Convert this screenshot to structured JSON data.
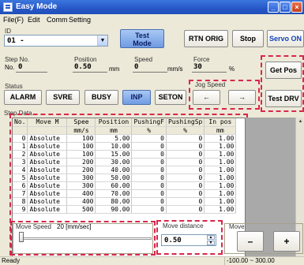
{
  "window": {
    "title": "Easy Mode"
  },
  "menu": [
    "File(F)",
    "Edit",
    "Comm",
    "Setting"
  ],
  "id": {
    "label": "ID",
    "value": "01 -"
  },
  "buttons": {
    "test_mode_line1": "Test",
    "test_mode_line2": "Mode",
    "rtn_orig": "RTN ORIG",
    "stop": "Stop",
    "servo_on": "Servo ON",
    "get_pos": "Get Pos",
    "test_drv": "Test DRV"
  },
  "readouts": {
    "step_no_label": "Step No.",
    "step_no_prefix": "No.",
    "step_no_value": "0",
    "position_label": "Position",
    "position_value": "0.50",
    "position_unit": "mm",
    "speed_label": "Speed",
    "speed_value": "0",
    "speed_unit": "mm/s",
    "force_label": "Force",
    "force_value": "30",
    "force_unit": "%"
  },
  "status": {
    "label": "Status",
    "badges": [
      "ALARM",
      "SVRE",
      "BUSY",
      "INP",
      "SETON"
    ]
  },
  "jog": {
    "label": "Jog Speed",
    "left": "←",
    "right": "→"
  },
  "step_data": {
    "label": "Step Data",
    "headers": [
      "No.",
      "Move M",
      "Spee",
      "Position",
      "PushingF",
      "PushingSp",
      "In pos"
    ],
    "units": [
      "",
      "",
      "mm/s",
      "mm",
      "%",
      "%",
      "mm"
    ],
    "rows": [
      [
        "0",
        "Absolute",
        "100",
        "5.00",
        "0",
        "0",
        "1.00"
      ],
      [
        "1",
        "Absolute",
        "100",
        "10.00",
        "0",
        "0",
        "1.00"
      ],
      [
        "2",
        "Absolute",
        "100",
        "15.00",
        "0",
        "0",
        "1.00"
      ],
      [
        "3",
        "Absolute",
        "200",
        "30.00",
        "0",
        "0",
        "1.00"
      ],
      [
        "4",
        "Absolute",
        "200",
        "40.00",
        "0",
        "0",
        "1.00"
      ],
      [
        "5",
        "Absolute",
        "300",
        "50.00",
        "0",
        "0",
        "1.00"
      ],
      [
        "6",
        "Absolute",
        "300",
        "60.00",
        "0",
        "0",
        "1.00"
      ],
      [
        "7",
        "Absolute",
        "400",
        "70.00",
        "0",
        "0",
        "1.00"
      ],
      [
        "8",
        "Absolute",
        "400",
        "80.00",
        "0",
        "0",
        "1.00"
      ],
      [
        "9",
        "Absolute",
        "500",
        "90.00",
        "0",
        "0",
        "1.00"
      ]
    ]
  },
  "move_speed": {
    "label": "Move Speed",
    "value_text": "20 [mm/sec]"
  },
  "move_distance": {
    "label": "Move distance",
    "value": "0.50"
  },
  "move": {
    "label": "Move",
    "minus": "–",
    "plus": "+"
  },
  "statusbar": {
    "left": "Ready",
    "range": "-100.00 ~ 300.00"
  },
  "colors": {
    "accent_dash": "#d8274b",
    "title_bar": "#2757c8"
  }
}
